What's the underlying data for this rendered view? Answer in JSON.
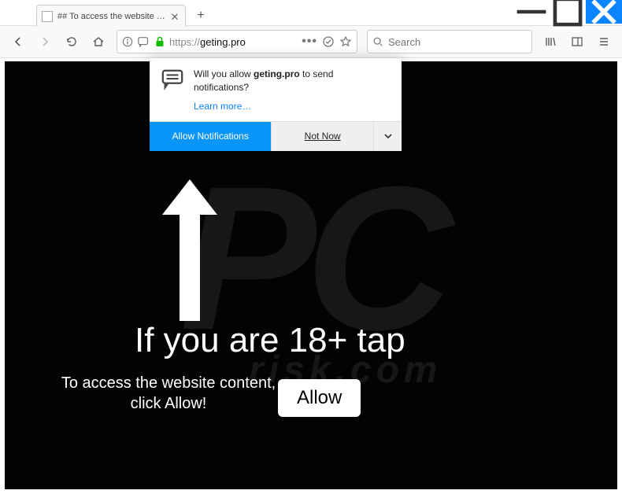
{
  "window": {
    "tab_title": "## To access the website content, c",
    "min": "—",
    "max": "🗖",
    "close": "✕",
    "newtab": "+"
  },
  "toolbar": {
    "url_protocol": "https://",
    "url_domain": "geting.pro",
    "search_placeholder": "Search"
  },
  "notification": {
    "prefix": "Will you allow ",
    "domain": "geting.pro",
    "suffix": " to send notifications?",
    "learn_more": "Learn more…",
    "allow": "Allow Notifications",
    "not_now": "Not Now"
  },
  "page": {
    "headline": "If you are 18+ tap",
    "subline": "To access the website content, click Allow!",
    "allow_button": "Allow",
    "watermark_main": "PC",
    "watermark_sub": "risk.com"
  }
}
